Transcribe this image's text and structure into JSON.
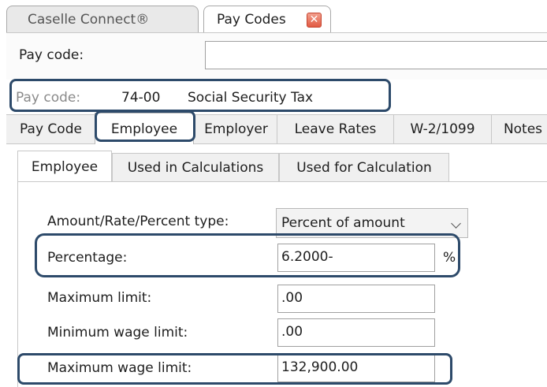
{
  "tabs": {
    "home": "Caselle Connect®",
    "pay_codes": "Pay Codes",
    "close_icon": "close-icon"
  },
  "search": {
    "label": "Pay code:",
    "value": ""
  },
  "current": {
    "label": "Pay code:",
    "code": "74-00",
    "description": "Social Security Tax"
  },
  "primary_tabs": [
    "Pay Code",
    "Employee",
    "Employer",
    "Leave Rates",
    "W-2/1099",
    "Notes"
  ],
  "secondary_tabs": [
    "Employee",
    "Used in Calculations",
    "Used for Calculation"
  ],
  "form": {
    "type_label": "Amount/Rate/Percent type:",
    "type_value": "Percent of amount",
    "percentage_label": "Percentage:",
    "percentage_value": "6.2000-",
    "percentage_unit": "%",
    "max_limit_label": "Maximum limit:",
    "max_limit_value": ".00",
    "min_wage_label": "Minimum wage limit:",
    "min_wage_value": ".00",
    "max_wage_label": "Maximum wage limit:",
    "max_wage_value": "132,900.00"
  },
  "colors": {
    "highlight": "#2d4a6a",
    "close": "#e25a43"
  }
}
